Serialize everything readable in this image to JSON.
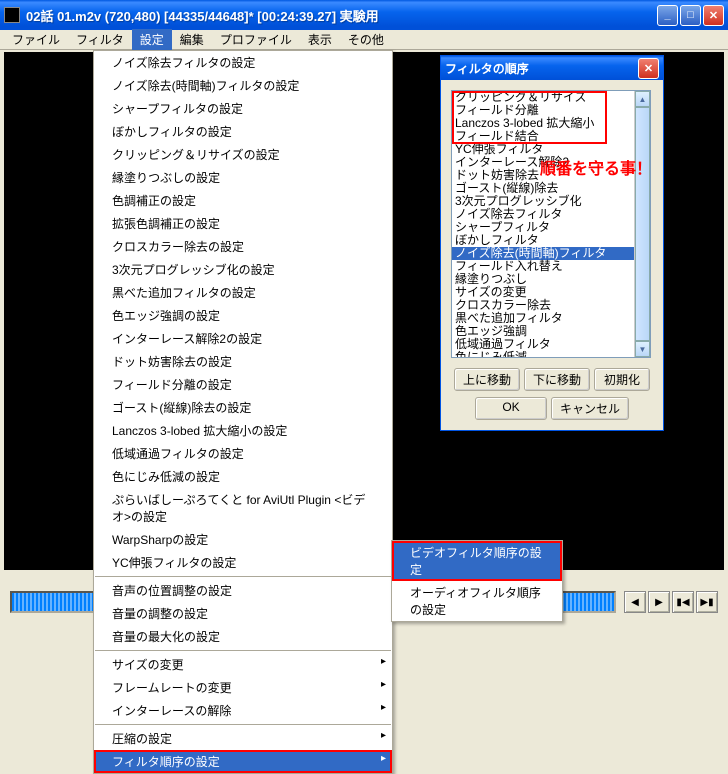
{
  "window": {
    "title": "02話 01.m2v (720,480) [44335/44648]* [00:24:39.27]  実験用"
  },
  "menubar": [
    "ファイル",
    "フィルタ",
    "設定",
    "編集",
    "プロファイル",
    "表示",
    "その他"
  ],
  "active_menu_index": 2,
  "dropdown": [
    {
      "label": "ノイズ除去フィルタの設定"
    },
    {
      "label": "ノイズ除去(時間軸)フィルタの設定"
    },
    {
      "label": "シャープフィルタの設定"
    },
    {
      "label": "ぼかしフィルタの設定"
    },
    {
      "label": "クリッピング＆リサイズの設定"
    },
    {
      "label": "縁塗りつぶしの設定"
    },
    {
      "label": "色調補正の設定"
    },
    {
      "label": "拡張色調補正の設定"
    },
    {
      "label": "クロスカラー除去の設定"
    },
    {
      "label": "3次元プログレッシブ化の設定"
    },
    {
      "label": "黒べた追加フィルタの設定"
    },
    {
      "label": "色エッジ強調の設定"
    },
    {
      "label": "インターレース解除2の設定"
    },
    {
      "label": "ドット妨害除去の設定"
    },
    {
      "label": "フィールド分離の設定"
    },
    {
      "label": "ゴースト(縦線)除去の設定"
    },
    {
      "label": "Lanczos 3-lobed 拡大縮小の設定"
    },
    {
      "label": "低域通過フィルタの設定"
    },
    {
      "label": "色にじみ低減の設定"
    },
    {
      "label": "ぷらいばしーぷろてくと for AviUtl Plugin <ビデオ>の設定"
    },
    {
      "label": "WarpSharpの設定"
    },
    {
      "label": "YC伸張フィルタの設定"
    },
    {
      "sep": true
    },
    {
      "label": "音声の位置調整の設定"
    },
    {
      "label": "音量の調整の設定"
    },
    {
      "label": "音量の最大化の設定"
    },
    {
      "sep": true
    },
    {
      "label": "サイズの変更",
      "sub": true
    },
    {
      "label": "フレームレートの変更",
      "sub": true
    },
    {
      "label": "インターレースの解除",
      "sub": true
    },
    {
      "sep": true
    },
    {
      "label": "圧縮の設定",
      "sub": true
    },
    {
      "label": "フィルタ順序の設定",
      "sub": true,
      "highlight": true,
      "redbox": true
    }
  ],
  "submenu": [
    {
      "label": "ビデオフィルタ順序の設定",
      "highlight": true
    },
    {
      "label": "オーディオフィルタ順序の設定"
    }
  ],
  "dialog": {
    "title": "フィルタの順序",
    "list": [
      "クリッピング＆リサイズ",
      "フィールド分離",
      "Lanczos 3-lobed 拡大縮小",
      "フィールド結合",
      "YC伸張フィルタ",
      "インターレース解除2",
      "ドット妨害除去",
      "ゴースト(縦線)除去",
      "3次元プログレッシブ化",
      "ノイズ除去フィルタ",
      "シャープフィルタ",
      "ぼかしフィルタ",
      "ノイズ除去(時間軸)フィルタ",
      "フィールド入れ替え",
      "縁塗りつぶし",
      "サイズの変更",
      "クロスカラー除去",
      "黒べた追加フィルタ",
      "色エッジ強調",
      "低域通過フィルタ",
      "色にじみ低減"
    ],
    "selected_index": 12,
    "redbox_range": [
      0,
      3
    ],
    "buttons": {
      "up": "上に移動",
      "down": "下に移動",
      "reset": "初期化",
      "ok": "OK",
      "cancel": "キャンセル"
    }
  },
  "annotation": "順番を守る事！"
}
